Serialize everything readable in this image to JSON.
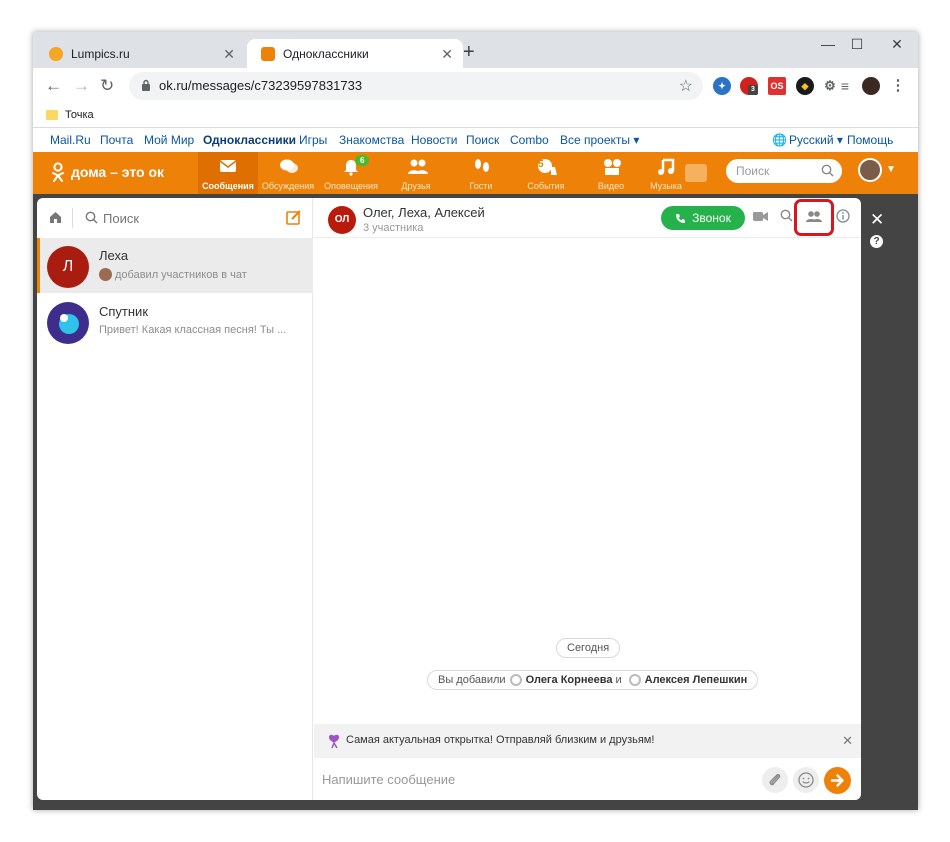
{
  "browser": {
    "tabs": [
      {
        "title": "Lumpics.ru",
        "close": "✕"
      },
      {
        "title": "Одноклассники",
        "close": "✕"
      }
    ],
    "new_tab": "+",
    "window_controls": {
      "minimize": "—",
      "maximize": "☐",
      "close": "✕"
    },
    "url": "ok.ru/messages/c73239597831733",
    "bookmark": "Точка",
    "extension_badge": "3",
    "extension_label": "OS"
  },
  "portal_links": [
    "Mail.Ru",
    "Почта",
    "Мой Мир",
    "Одноклассники",
    "Игры",
    "Знакомства",
    "Новости",
    "Поиск",
    "Combo",
    "Все проекты ▾"
  ],
  "portal_right": {
    "language": "Русский ▾",
    "help": "Помощь"
  },
  "ok_nav": {
    "logo": "дома – это ок",
    "items": [
      {
        "label": "Сообщения",
        "icon": "envelope-icon"
      },
      {
        "label": "Обсуждения",
        "icon": "chat-bubbles-icon"
      },
      {
        "label": "Оповещения",
        "icon": "bell-icon",
        "badge": "6"
      },
      {
        "label": "Друзья",
        "icon": "friends-icon"
      },
      {
        "label": "Гости",
        "icon": "footprints-icon"
      },
      {
        "label": "События",
        "icon": "events-icon",
        "badge": "5"
      },
      {
        "label": "Видео",
        "icon": "video-icon"
      },
      {
        "label": "Музыка",
        "icon": "music-icon"
      }
    ],
    "search_placeholder": "Поиск"
  },
  "messenger": {
    "search_placeholder": "Поиск",
    "chats": [
      {
        "initial": "Л",
        "name": "Леха",
        "preview": "добавил участников в чат",
        "color": "#a91c10"
      },
      {
        "name": "Спутник",
        "preview": "Привет! Какая классная песня! Ты ...",
        "color": "#3f2d8e"
      }
    ],
    "header": {
      "initials": "ОЛ",
      "title": "Олег, Леха, Алексей",
      "subtitle": "3 участника",
      "call_label": "Звонок"
    },
    "day_separator": "Сегодня",
    "system_message": {
      "prefix": "Вы добавили",
      "user1": "Олега Корнеева",
      "conj": "и",
      "user2": "Алексея Лепешкин"
    },
    "promo_text": "Самая актуальная открытка! Отправляй близким и друзьям!",
    "promo_close": "✕",
    "composer_placeholder": "Напишите сообщение"
  },
  "colors": {
    "ok_orange": "#ee8208",
    "call_green": "#26b24b",
    "highlight_red": "#d8161f"
  }
}
